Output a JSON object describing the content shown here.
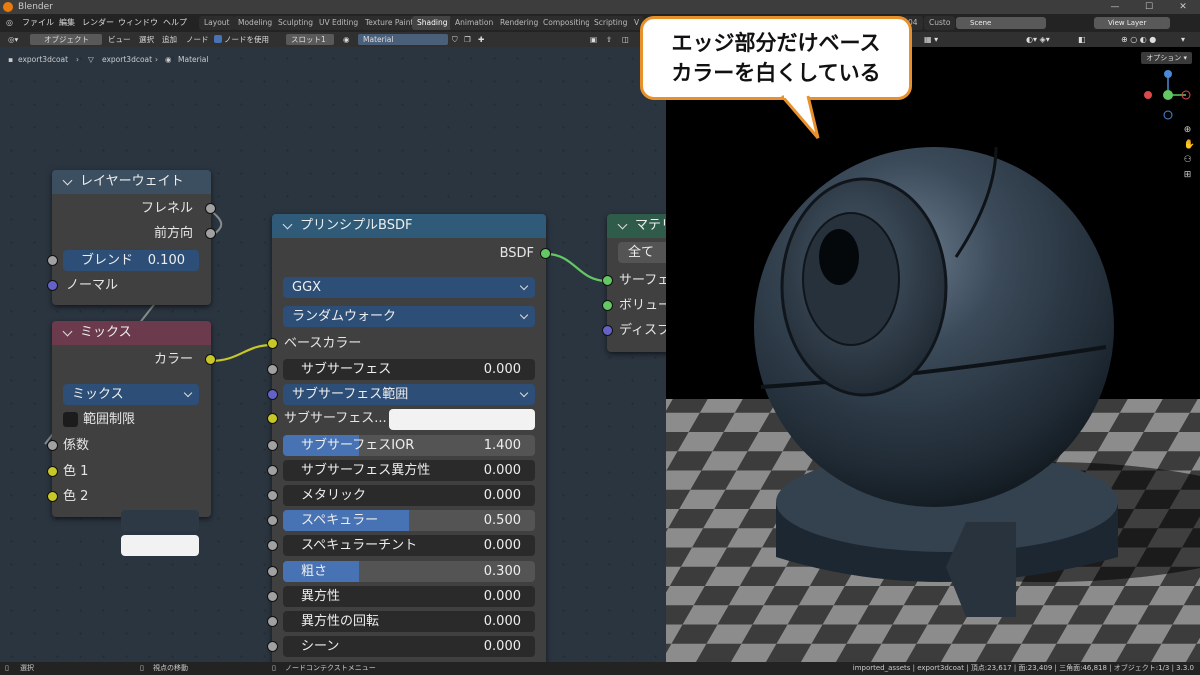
{
  "window": {
    "title": "Blender"
  },
  "menubar": {
    "menus": [
      "ファイル",
      "編集",
      "レンダー",
      "ウィンドウ",
      "ヘルプ"
    ],
    "workspaces": [
      "Layout",
      "Modeling",
      "Sculpting",
      "UV Editing",
      "Texture Paint",
      "Shading",
      "Animation",
      "Rendering",
      "Compositing",
      "Scripting",
      "V"
    ],
    "extra_tabs": [
      "04",
      "Custo"
    ],
    "scene": "Scene",
    "view_layer": "View Layer"
  },
  "node_header": {
    "object_mode": "オブジェクト",
    "view": "ビュー",
    "select": "選択",
    "add": "追加",
    "node": "ノード",
    "use_nodes": "ノードを使用",
    "slot": "スロット1",
    "material": "Material"
  },
  "breadcrumb": [
    "export3dcoat",
    "export3dcoat",
    "Material"
  ],
  "viewport": {
    "options": "オプション"
  },
  "callout": {
    "line1": "エッジ部分だけベース",
    "line2": "カラーを白くしている"
  },
  "layer_weight": {
    "title": "レイヤーウェイト",
    "out_fresnel": "フレネル",
    "out_facing": "前方向",
    "blend_label": "ブレンド",
    "blend_value": "0.100",
    "blend_fraction": 0.1,
    "in_normal": "ノーマル"
  },
  "mix": {
    "title": "ミックス",
    "out_color": "カラー",
    "blend_type": "ミックス",
    "clamp": "範囲制限",
    "in_fac": "係数",
    "in_color1": "色 1",
    "in_color2": "色 2",
    "color1": "#2d3a46",
    "color2": "#f2f2f2"
  },
  "bsdf": {
    "title": "プリンシプルBSDF",
    "out": "BSDF",
    "distribution": "GGX",
    "subsurface_method": "ランダムウォーク",
    "base_color": "ベースカラー",
    "subsurface_label": "サブサーフェス",
    "subsurface_value": "0.000",
    "subsurface_radius": "サブサーフェス範囲",
    "subsurface_color": "サブサーフェス...",
    "ior_label": "サブサーフェスIOR",
    "ior_value": "1.400",
    "ior_fraction": 0.3,
    "aniso_sub_label": "サブサーフェス異方性",
    "aniso_sub_value": "0.000",
    "metallic_label": "メタリック",
    "metallic_value": "0.000",
    "specular_label": "スペキュラー",
    "specular_value": "0.500",
    "specular_fraction": 0.5,
    "spec_tint_label": "スペキュラーチント",
    "spec_tint_value": "0.000",
    "roughness_label": "粗さ",
    "roughness_value": "0.300",
    "roughness_fraction": 0.3,
    "aniso_label": "異方性",
    "aniso_value": "0.000",
    "aniso_rot_label": "異方性の回転",
    "aniso_rot_value": "0.000",
    "sheen_label": "シーン",
    "sheen_value": "0.000"
  },
  "material_output": {
    "title": "マテリ",
    "target": "全て",
    "in_surface": "サーフェ",
    "in_volume": "ボリュー",
    "in_displacement": "ディスプ"
  },
  "statusbar": {
    "select": "選択",
    "move_view": "視点の移動",
    "context_menu": "ノードコンテクストメニュー",
    "stats": "imported_assets | export3dcoat | 頂点:23,617 | 面:23,409 | 三角面:46,818 | オブジェクト:1/3 | 3.3.0"
  },
  "colors": {
    "accent": "#4772b3",
    "dropdown": "#2d4e76",
    "callout_border": "#e8912c",
    "layer_weight_header": "#3b4f61",
    "mix_header": "#6b3a4c",
    "bsdf_header": "#2f5b78",
    "output_header": "#2f5b4a"
  }
}
